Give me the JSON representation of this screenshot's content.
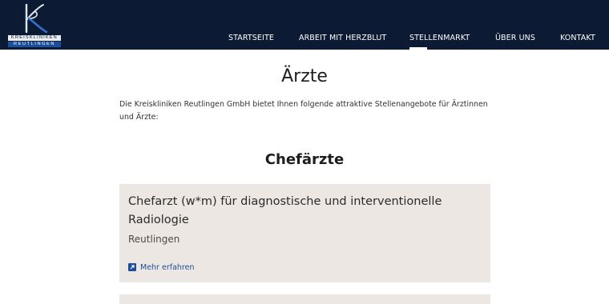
{
  "brand": {
    "line1": "KREISKLINIKEN",
    "line2": "REUTLINGEN",
    "colors": {
      "navy": "#0c1a33",
      "blue": "#1b4f9c"
    }
  },
  "nav": {
    "items": [
      {
        "label": "STARTSEITE",
        "active": false
      },
      {
        "label": "ARBEIT MIT HERZBLUT",
        "active": false
      },
      {
        "label": "STELLENMARKT",
        "active": true
      },
      {
        "label": "ÜBER UNS",
        "active": false
      },
      {
        "label": "KONTAKT",
        "active": false
      }
    ]
  },
  "main": {
    "title": "Ärzte",
    "intro": "Die Kreiskliniken Reutlingen GmbH bietet Ihnen folgende attraktive Stellenangebote für Ärztinnen und Ärzte:",
    "sections": [
      {
        "title": "Chefärzte",
        "jobs": [
          {
            "title": "Chefarzt (w*m) für diagnostische und interventionelle Radiologie",
            "location": "Reutlingen",
            "link_label": "Mehr erfahren",
            "link_icon": "external-link-icon"
          }
        ]
      }
    ]
  }
}
